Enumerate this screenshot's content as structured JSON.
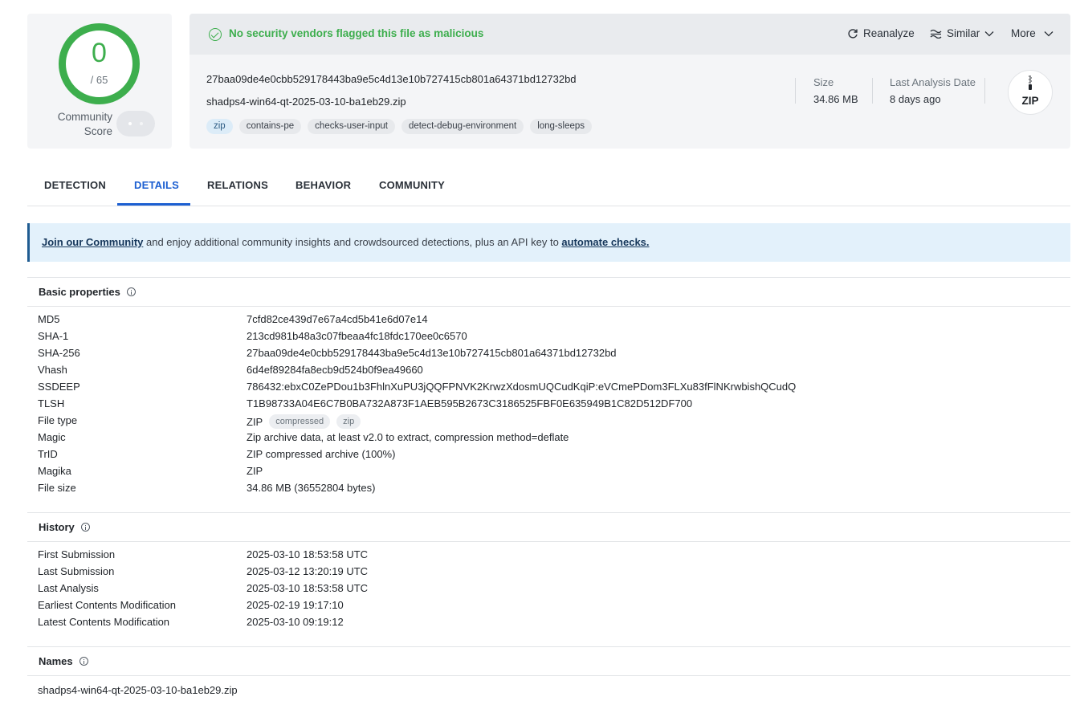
{
  "score": {
    "detections": "0",
    "total": "/ 65",
    "community_label_1": "Community",
    "community_label_2": "Score"
  },
  "status": {
    "text": "No security vendors flagged this file as malicious",
    "color": "#3dae4d"
  },
  "actions": {
    "reanalyze": "Reanalyze",
    "similar": "Similar",
    "more": "More"
  },
  "file": {
    "sha256": "27baa09de4e0cbb529178443ba9e5c4d13e10b727415cb801a64371bd12732bd",
    "name": "shadps4-win64-qt-2025-03-10-ba1eb29.zip",
    "tags": [
      "zip",
      "contains-pe",
      "checks-user-input",
      "detect-debug-environment",
      "long-sleeps"
    ],
    "size_label": "Size",
    "size_value": "34.86 MB",
    "last_analysis_label": "Last Analysis Date",
    "last_analysis_value": "8 days ago",
    "type_badge": "ZIP"
  },
  "tabs": [
    "DETECTION",
    "DETAILS",
    "RELATIONS",
    "BEHAVIOR",
    "COMMUNITY"
  ],
  "active_tab": "DETAILS",
  "banner": {
    "link1": "Join our Community",
    "middle": " and enjoy additional community insights and crowdsourced detections, plus an API key to ",
    "link2": "automate checks."
  },
  "basic_properties": {
    "title": "Basic properties",
    "rows": [
      {
        "key": "MD5",
        "value": "7cfd82ce439d7e67a4cd5b41e6d07e14"
      },
      {
        "key": "SHA-1",
        "value": "213cd981b48a3c07fbeaa4fc18fdc170ee0c6570"
      },
      {
        "key": "SHA-256",
        "value": "27baa09de4e0cbb529178443ba9e5c4d13e10b727415cb801a64371bd12732bd"
      },
      {
        "key": "Vhash",
        "value": "6d4ef89284fa8ecb9d524b0f9ea49660"
      },
      {
        "key": "SSDEEP",
        "value": "786432:ebxC0ZePDou1b3FhlnXuPU3jQQFPNVK2KrwzXdosmUQCudKqiP:eVCmePDom3FLXu83fFlNKrwbishQCudQ"
      },
      {
        "key": "TLSH",
        "value": "T1B98733A04E6C7B0BA732A873F1AEB595B2673C3186525FBF0E635949B1C82D512DF700"
      },
      {
        "key": "File type",
        "value": "ZIP",
        "tags": [
          "compressed",
          "zip"
        ]
      },
      {
        "key": "Magic",
        "value": "Zip archive data, at least v2.0 to extract, compression method=deflate"
      },
      {
        "key": "TrID",
        "value": "ZIP compressed archive (100%)"
      },
      {
        "key": "Magika",
        "value": "ZIP"
      },
      {
        "key": "File size",
        "value": "34.86 MB (36552804 bytes)"
      }
    ]
  },
  "history": {
    "title": "History",
    "rows": [
      {
        "key": "First Submission",
        "value": "2025-03-10 18:53:58 UTC"
      },
      {
        "key": "Last Submission",
        "value": "2025-03-12 13:20:19 UTC"
      },
      {
        "key": "Last Analysis",
        "value": "2025-03-10 18:53:58 UTC"
      },
      {
        "key": "Earliest Contents Modification",
        "value": "2025-02-19 19:17:10"
      },
      {
        "key": "Latest Contents Modification",
        "value": "2025-03-10 09:19:12"
      }
    ]
  },
  "names": {
    "title": "Names",
    "items": [
      "shadps4-win64-qt-2025-03-10-ba1eb29.zip"
    ]
  }
}
